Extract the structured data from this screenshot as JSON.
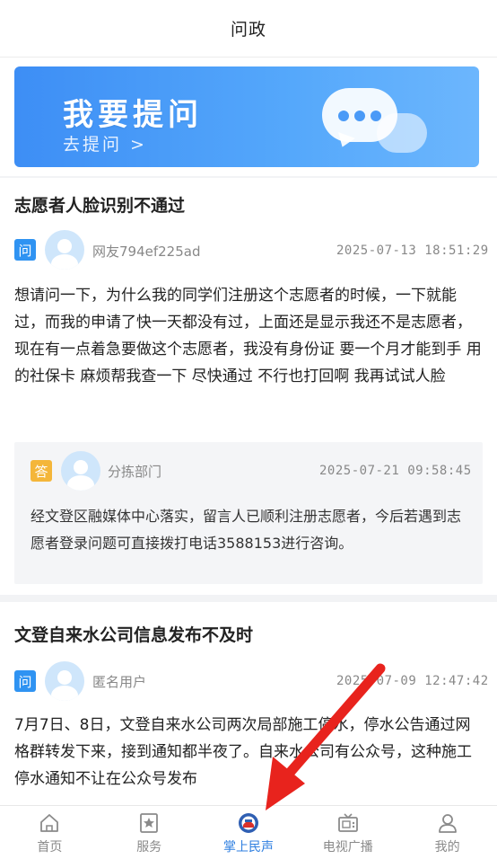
{
  "header": {
    "title": "问政"
  },
  "banner": {
    "title": "我要提问",
    "subtitle": "去提问 >"
  },
  "posts": [
    {
      "title": "志愿者人脸识别不通过",
      "badge": "问",
      "user": "网友794ef225ad",
      "time": "2025-07-13  18:51:29",
      "content": "想请问一下，为什么我的同学们注册这个志愿者的时候，一下就能过，而我的申请了快一天都没有过，上面还是显示我还不是志愿者，现在有一点着急要做这个志愿者，我没有身份证  要一个月才能到手  用的社保卡  麻烦帮我查一下  尽快通过  不行也打回啊  我再试试人脸",
      "reply": {
        "badge": "答",
        "department": "分拣部门",
        "time": "2025-07-21  09:58:45",
        "content": "经文登区融媒体中心落实，留言人已顺利注册志愿者，今后若遇到志愿者登录问题可直接拨打电话3588153进行咨询。"
      }
    },
    {
      "title": "文登自来水公司信息发布不及时",
      "badge": "问",
      "user": "匿名用户",
      "time": "2025-07-09  12:47:42",
      "content": "7月7日、8日，文登自来水公司两次局部施工停水，停水公告通过网格群转发下来，接到通知都半夜了。自来水公司有公众号，这种施工停水通知不让在公众号发布"
    }
  ],
  "tabs": [
    {
      "label": "首页",
      "icon": "home-icon"
    },
    {
      "label": "服务",
      "icon": "service-icon"
    },
    {
      "label": "掌上民声",
      "icon": "logo-icon",
      "active": true
    },
    {
      "label": "电视广播",
      "icon": "tv-icon"
    },
    {
      "label": "我的",
      "icon": "user-icon"
    }
  ],
  "colors": {
    "accent": "#2f7fe0",
    "question_badge": "#2f93f2",
    "answer_badge": "#f4b63a",
    "arrow": "#e8231d"
  }
}
